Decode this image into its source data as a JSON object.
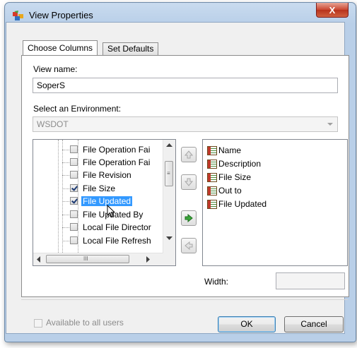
{
  "window": {
    "title": "View Properties",
    "close_glyph": "X"
  },
  "tabs": [
    {
      "label": "Choose Columns",
      "active": true
    },
    {
      "label": "Set Defaults",
      "active": false
    }
  ],
  "view_name": {
    "label": "View name:",
    "value": "SoperS"
  },
  "environment": {
    "label": "Select an Environment:",
    "value": "WSDOT",
    "disabled": true
  },
  "tree": {
    "items": [
      {
        "label": "File Operation Fai",
        "checked": false,
        "selected": false
      },
      {
        "label": "File Operation Fai",
        "checked": false,
        "selected": false
      },
      {
        "label": "File Revision",
        "checked": false,
        "selected": false
      },
      {
        "label": "File Size",
        "checked": true,
        "selected": false
      },
      {
        "label": "File Updated",
        "checked": true,
        "selected": true
      },
      {
        "label": "File Updated By",
        "checked": false,
        "selected": false
      },
      {
        "label": "Local File Director",
        "checked": false,
        "selected": false
      },
      {
        "label": "Local File Refresh",
        "checked": false,
        "selected": false
      }
    ],
    "hscroll_grip": "III",
    "vscroll_grip": "≡"
  },
  "move_buttons": [
    {
      "name": "move-up",
      "icon": "up-arrow-icon",
      "enabled": false
    },
    {
      "name": "move-down",
      "icon": "down-arrow-icon",
      "enabled": false
    },
    {
      "name": "add-column",
      "icon": "right-arrow-icon",
      "enabled": true
    },
    {
      "name": "remove-column",
      "icon": "left-arrow-icon",
      "enabled": false
    }
  ],
  "selected_columns": [
    {
      "label": "Name",
      "icon": "table-icon"
    },
    {
      "label": "Description",
      "icon": "table-icon"
    },
    {
      "label": "File Size",
      "icon": "table-icon"
    },
    {
      "label": "Out to",
      "icon": "table-icon"
    },
    {
      "label": "File Updated",
      "icon": "table-icon"
    }
  ],
  "width": {
    "label": "Width:",
    "value": ""
  },
  "available_to_all": {
    "label": "Available to all users",
    "checked": false,
    "disabled": true
  },
  "buttons": {
    "ok": "OK",
    "cancel": "Cancel"
  },
  "colors": {
    "selection": "#3399ff",
    "arrow_green": "#3aa63a",
    "close_red": "#c9452f"
  }
}
